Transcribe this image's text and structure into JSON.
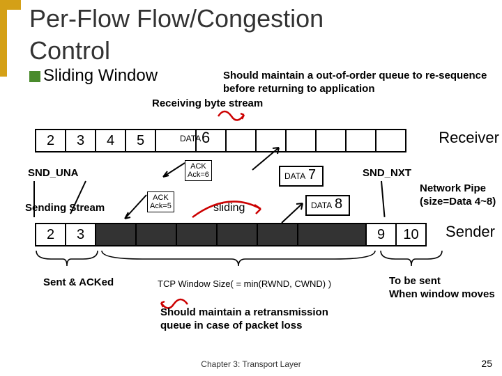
{
  "title_line1": "Per-Flow Flow/Congestion",
  "title_line2": "Control",
  "subtitle": "Sliding Window",
  "note_top": "Should maintain a out-of-order queue to re-sequence before returning  to application",
  "receiving_label": "Receiving byte stream",
  "receiver": {
    "cells": [
      "2",
      "3",
      "4",
      "5",
      "",
      "",
      "",
      "",
      "",
      "",
      "",
      ""
    ],
    "data6_label": "DATA",
    "data6_num": "6",
    "label": "Receiver"
  },
  "snd_una": "SND_UNA",
  "snd_nxt": "SND_NXT",
  "ack6": "ACK\nAck=6",
  "ack5": "ACK\nAck=5",
  "data7_label": "DATA",
  "data7_num": "7",
  "data8_label": "DATA",
  "data8_num": "8",
  "sliding": "sliding",
  "sending_stream": "Sending Stream",
  "pipe_note": "Network Pipe\n(size=Data 4~8)",
  "sender": {
    "cells": [
      "2",
      "3",
      "",
      "",
      "",
      "",
      "",
      "",
      "9",
      "10"
    ],
    "dark_indices": [
      2,
      3,
      4,
      5,
      6,
      7
    ],
    "label": "Sender"
  },
  "sent_acked": "Sent & ACKed",
  "window_size": "TCP Window Size( = min(RWND, CWND) )",
  "to_be_sent": "To be sent\nWhen window moves",
  "note_bottom": "Should maintain a retransmission\nqueue in case of packet loss",
  "footer": "Chapter 3: Transport Layer",
  "page": "25"
}
